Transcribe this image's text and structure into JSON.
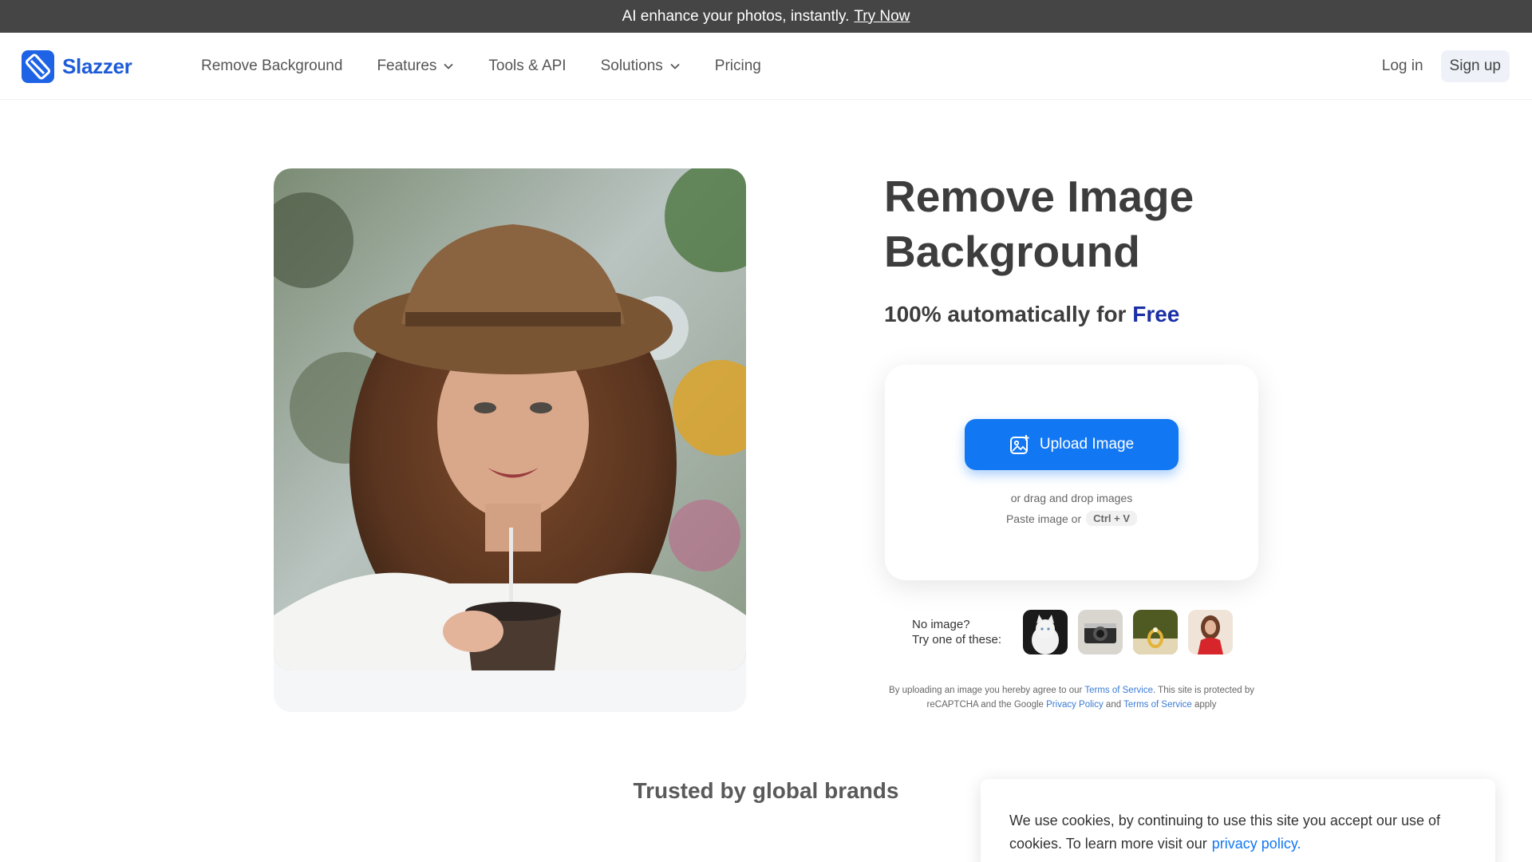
{
  "topbar": {
    "text": "AI enhance your photos, instantly.",
    "link": "Try Now"
  },
  "header": {
    "brand": "Slazzer",
    "nav": [
      {
        "label": "Remove Background",
        "has_dropdown": false
      },
      {
        "label": "Features",
        "has_dropdown": true
      },
      {
        "label": "Tools & API",
        "has_dropdown": false
      },
      {
        "label": "Solutions",
        "has_dropdown": true
      },
      {
        "label": "Pricing",
        "has_dropdown": false
      }
    ],
    "login": "Log in",
    "signup": "Sign up"
  },
  "hero": {
    "title_line1": "Remove Image",
    "title_line2": "Background",
    "sub_prefix": "100% automatically for",
    "sub_highlight": "Free"
  },
  "upload": {
    "button": "Upload Image",
    "drag": "or drag and drop images",
    "paste": "Paste image or",
    "shortcut": "Ctrl + V"
  },
  "samples": {
    "prompt_line1": "No image?",
    "prompt_line2": "Try one of these:",
    "items": [
      "cat-sample",
      "camera-sample",
      "ring-sample",
      "woman-sample"
    ]
  },
  "legal": {
    "p1": "By uploading an image you hereby agree to our",
    "tos": "Terms of Service",
    "p2": ". This site is protected by reCAPTCHA and the Google",
    "privacy": "Privacy Policy",
    "p3": "and",
    "tos2": "Terms of Service",
    "p4": "apply"
  },
  "trusted": "Trusted by global brands",
  "cookie": {
    "text": "We use cookies, by continuing to use this site you accept our use of cookies.  To learn more visit our",
    "link": "privacy policy."
  },
  "colors": {
    "accent": "#1277f3",
    "brand": "#1e63e6",
    "free": "#1b2fa6",
    "topbar": "#454545"
  }
}
